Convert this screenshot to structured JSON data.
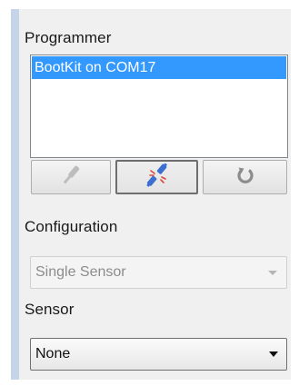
{
  "programmer": {
    "label": "Programmer",
    "items": [
      "BootKit on COM17"
    ]
  },
  "toolbar": {
    "buttons": [
      {
        "icon": "plug-icon",
        "state": "disabled"
      },
      {
        "icon": "disconnect-icon",
        "state": "pressed"
      },
      {
        "icon": "refresh-icon",
        "state": "enabled"
      }
    ]
  },
  "configuration": {
    "label": "Configuration",
    "selected": "Single Sensor",
    "enabled": false
  },
  "sensor": {
    "label": "Sensor",
    "selected": "None",
    "enabled": true
  },
  "colors": {
    "panel_bg": "#f0f0f0",
    "panel_accent": "#c6d4ea",
    "selection": "#3399ff"
  }
}
